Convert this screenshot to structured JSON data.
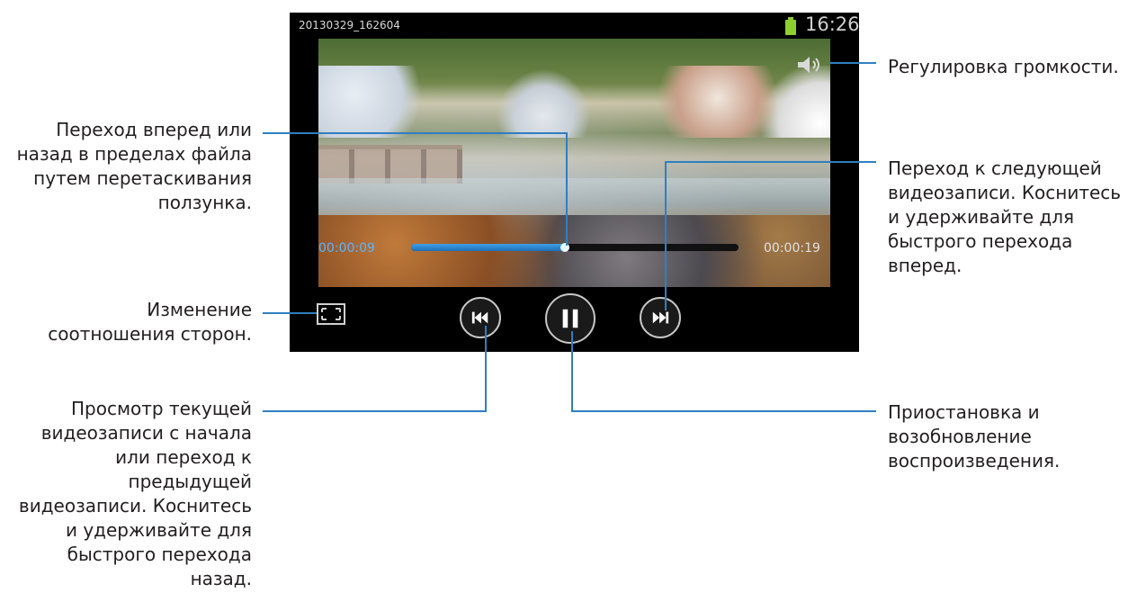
{
  "screen": {
    "filename": "20130329_162604",
    "clock": "16:26",
    "current_time": "00:00:09",
    "total_time": "00:00:19",
    "progress": 0.47,
    "colors": {
      "accent": "#3f9fe6",
      "battery": "#8fce2f",
      "background": "#000000"
    },
    "icons": [
      "battery-icon",
      "volume-icon",
      "aspect-ratio-icon",
      "previous-icon",
      "pause-icon",
      "next-icon"
    ]
  },
  "callouts": {
    "volume": "Регулировка громкости.",
    "seek": "Переход вперед или\nназад в пределах файла\nпутем перетаскивания\nползунка.",
    "next": "Переход к следующей\nвидеозаписи. Коснитесь\nи удерживайте для\nбыстрого перехода\nвперед.",
    "ratio": "Изменение\nсоотношения сторон.",
    "previous": "Просмотр текущей\nвидеозаписи с начала\nили переход к\nпредыдущей\nвидеозаписи. Коснитесь\nи удерживайте для\nбыстрого перехода\nназад.",
    "pause": "Приостановка и\nвозобновление\nвоспроизведения."
  }
}
